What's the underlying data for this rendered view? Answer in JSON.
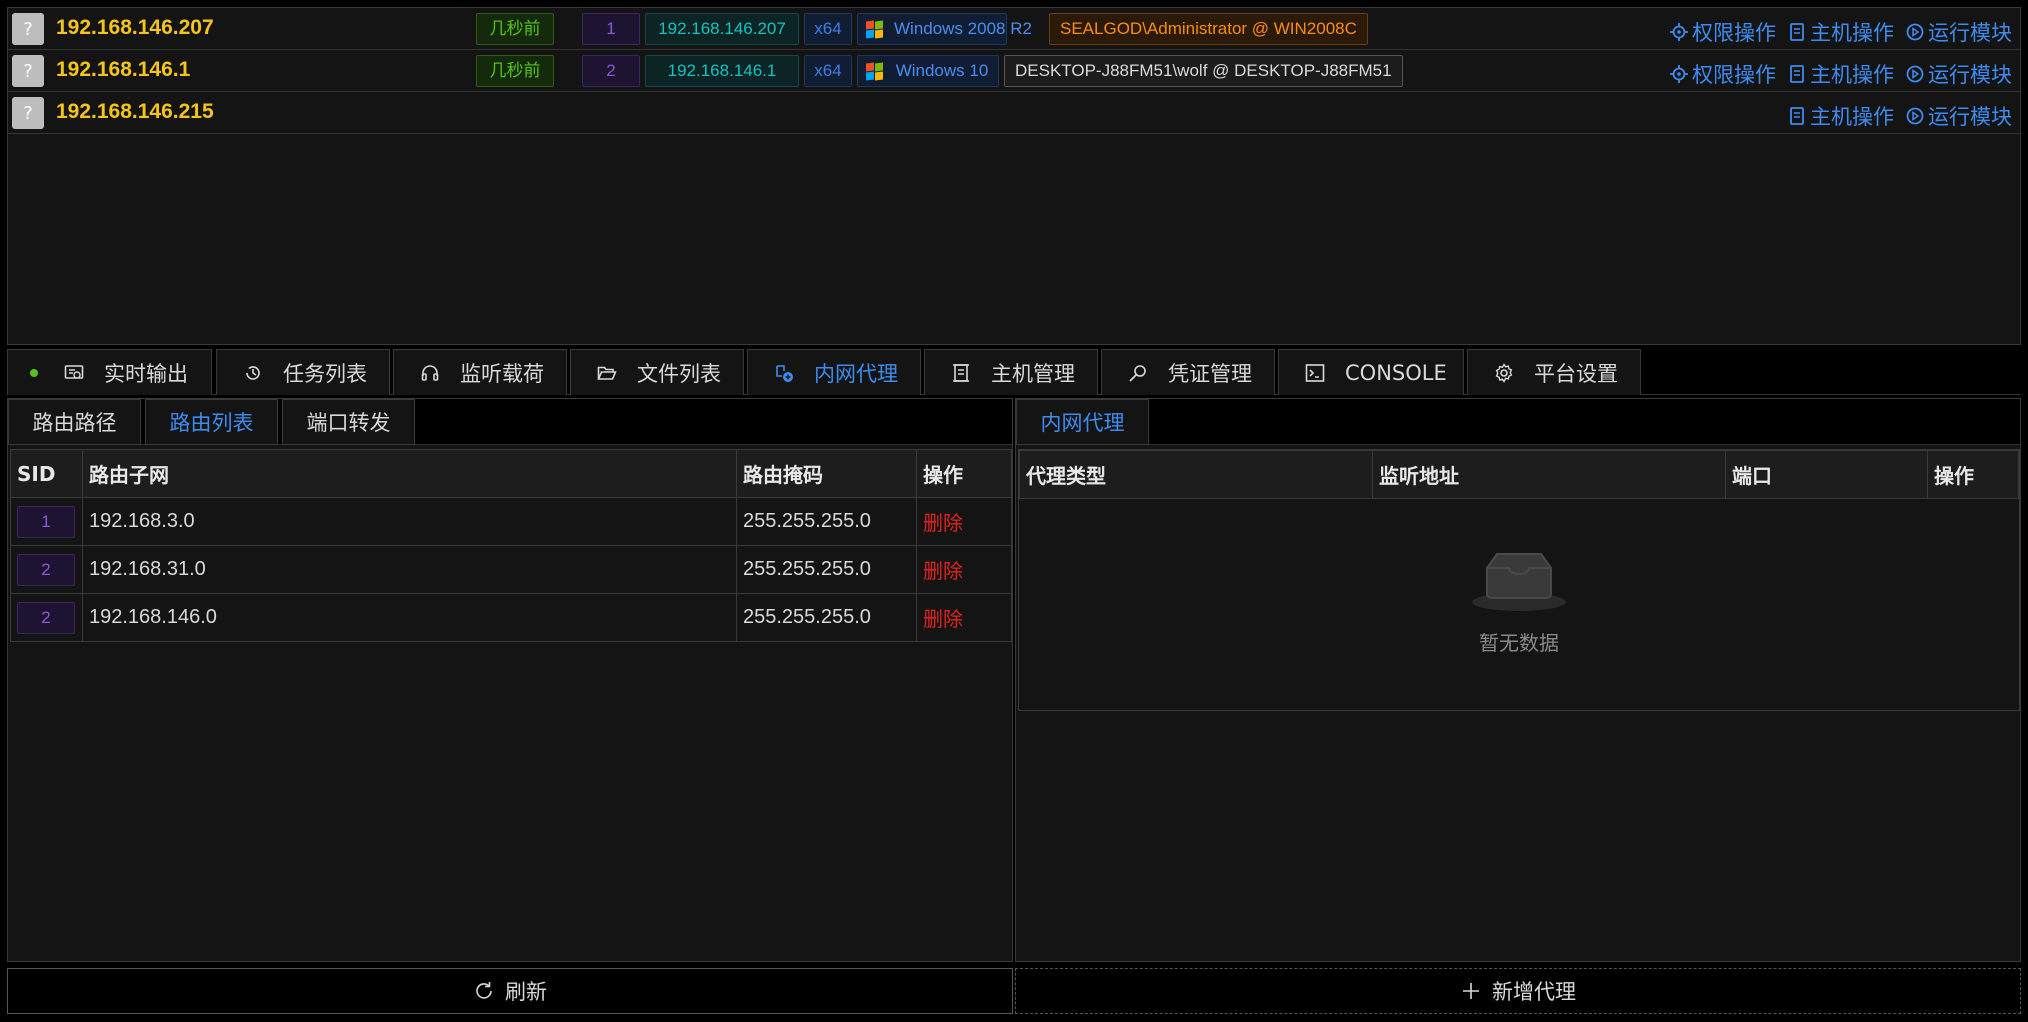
{
  "hosts": [
    {
      "icon": "?",
      "ip": "192.168.146.207",
      "time": "几秒前",
      "sid": "1",
      "internal_ip": "192.168.146.207",
      "arch": "x64",
      "os": "Windows 2008 R2",
      "user": "SEALGOD\\Administrator @ WIN2008C",
      "actions": [
        "权限操作",
        "主机操作",
        "运行模块"
      ]
    },
    {
      "icon": "?",
      "ip": "192.168.146.1",
      "time": "几秒前",
      "sid": "2",
      "internal_ip": "192.168.146.1",
      "arch": "x64",
      "os": "Windows 10",
      "user": "DESKTOP-J88FM51\\wolf @ DESKTOP-J88FM51",
      "actions": [
        "权限操作",
        "主机操作",
        "运行模块"
      ]
    },
    {
      "icon": "?",
      "ip": "192.168.146.215",
      "actions": [
        "主机操作",
        "运行模块"
      ]
    }
  ],
  "main_tabs": [
    {
      "label": "实时输出",
      "icon": "monitor-icon"
    },
    {
      "label": "任务列表",
      "icon": "history-icon"
    },
    {
      "label": "监听载荷",
      "icon": "headset-icon"
    },
    {
      "label": "文件列表",
      "icon": "folder-open-icon"
    },
    {
      "label": "内网代理",
      "icon": "proxy-icon",
      "active": true
    },
    {
      "label": "主机管理",
      "icon": "server-icon"
    },
    {
      "label": "凭证管理",
      "icon": "search-key-icon"
    },
    {
      "label": "CONSOLE",
      "icon": "terminal-icon"
    },
    {
      "label": "平台设置",
      "icon": "gear-icon"
    }
  ],
  "left_panel": {
    "tabs": [
      {
        "label": "路由路径"
      },
      {
        "label": "路由列表",
        "active": true
      },
      {
        "label": "端口转发"
      }
    ],
    "columns": [
      "SID",
      "路由子网",
      "路由掩码",
      "操作"
    ],
    "rows": [
      {
        "sid": "1",
        "subnet": "192.168.3.0",
        "mask": "255.255.255.0",
        "action": "删除"
      },
      {
        "sid": "2",
        "subnet": "192.168.31.0",
        "mask": "255.255.255.0",
        "action": "删除"
      },
      {
        "sid": "2",
        "subnet": "192.168.146.0",
        "mask": "255.255.255.0",
        "action": "删除"
      }
    ],
    "refresh_label": "刷新"
  },
  "right_panel": {
    "tabs": [
      {
        "label": "内网代理",
        "active": true
      }
    ],
    "columns": [
      "代理类型",
      "监听地址",
      "端口",
      "操作"
    ],
    "empty_text": "暂无数据",
    "add_label": "新增代理"
  },
  "colors": {
    "accent": "#3d8cf0",
    "host_ip": "#f5c518",
    "delete": "#e0241c",
    "online_dot": "#52c41a"
  }
}
